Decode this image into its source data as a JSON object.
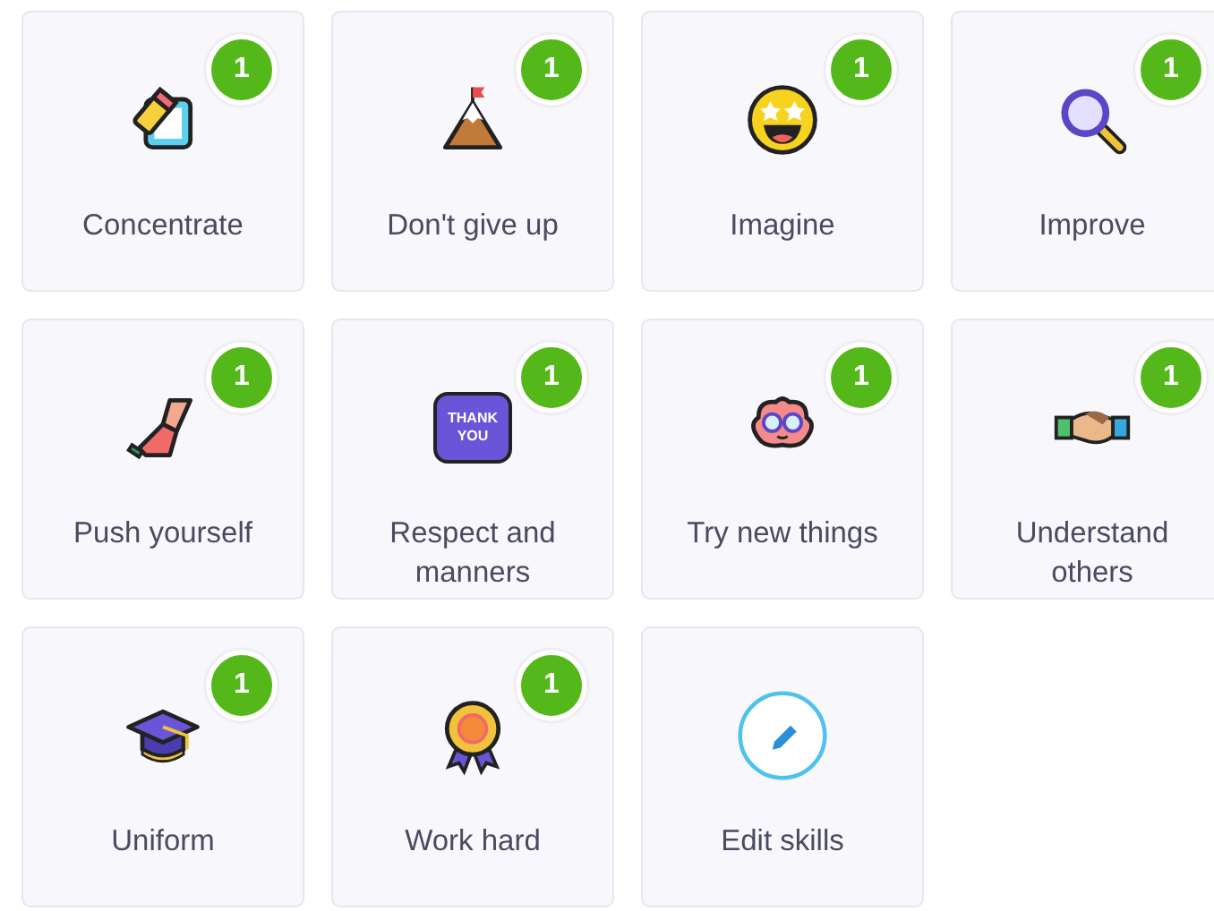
{
  "skills": [
    {
      "kind": "pencil-note",
      "label": "Concentrate",
      "count": "1"
    },
    {
      "kind": "mountain",
      "label": "Don't give up",
      "count": "1"
    },
    {
      "kind": "star-eyes-face",
      "label": "Imagine",
      "count": "1"
    },
    {
      "kind": "magnifier",
      "label": "Improve",
      "count": "1"
    },
    {
      "kind": "shoe",
      "label": "Push yourself",
      "count": "1"
    },
    {
      "kind": "thank-you",
      "label": "Respect and manners",
      "count": "1",
      "icon_text": "THANK YOU"
    },
    {
      "kind": "brain",
      "label": "Try new things",
      "count": "1"
    },
    {
      "kind": "handshake",
      "label": "Understand others",
      "count": "1"
    },
    {
      "kind": "grad-cap",
      "label": "Uniform",
      "count": "1"
    },
    {
      "kind": "rosette",
      "label": "Work hard",
      "count": "1"
    },
    {
      "kind": "edit",
      "label": "Edit skills"
    }
  ]
}
